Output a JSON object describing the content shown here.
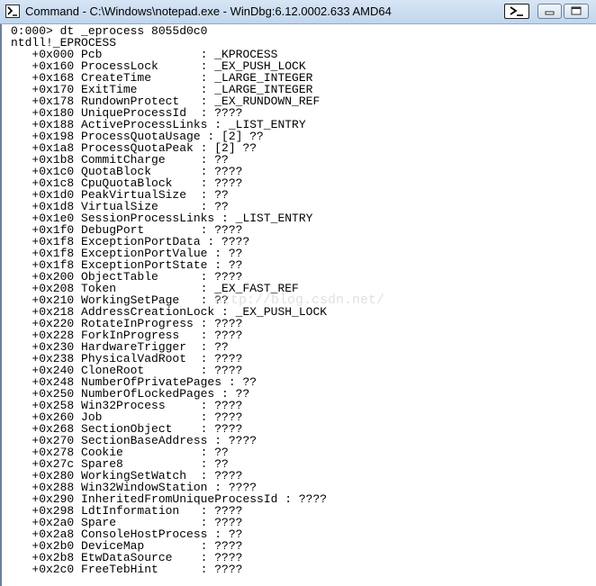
{
  "window": {
    "title": "Command - C:\\Windows\\notepad.exe - WinDbg:6.12.0002.633 AMD64",
    "title_icon": "command-window-icon",
    "controls": {
      "console_icon": "console-icon",
      "minimize_icon": "minimize-icon",
      "maximize_icon": "maximize-icon"
    }
  },
  "output": {
    "lines": [
      "0:000> dt _eprocess 8055d0c0",
      "ntdll!_EPROCESS",
      "   +0x000 Pcb              : _KPROCESS",
      "   +0x160 ProcessLock      : _EX_PUSH_LOCK",
      "   +0x168 CreateTime       : _LARGE_INTEGER",
      "   +0x170 ExitTime         : _LARGE_INTEGER",
      "   +0x178 RundownProtect   : _EX_RUNDOWN_REF",
      "   +0x180 UniqueProcessId  : ????",
      "   +0x188 ActiveProcessLinks : _LIST_ENTRY",
      "   +0x198 ProcessQuotaUsage : [2] ??",
      "   +0x1a8 ProcessQuotaPeak : [2] ??",
      "   +0x1b8 CommitCharge     : ??",
      "   +0x1c0 QuotaBlock       : ????",
      "   +0x1c8 CpuQuotaBlock    : ????",
      "   +0x1d0 PeakVirtualSize  : ??",
      "   +0x1d8 VirtualSize      : ??",
      "   +0x1e0 SessionProcessLinks : _LIST_ENTRY",
      "   +0x1f0 DebugPort        : ????",
      "   +0x1f8 ExceptionPortData : ????",
      "   +0x1f8 ExceptionPortValue : ??",
      "   +0x1f8 ExceptionPortState : ??",
      "   +0x200 ObjectTable      : ????",
      "   +0x208 Token            : _EX_FAST_REF",
      "   +0x210 WorkingSetPage   : ??",
      "   +0x218 AddressCreationLock : _EX_PUSH_LOCK",
      "   +0x220 RotateInProgress : ????",
      "   +0x228 ForkInProgress   : ????",
      "   +0x230 HardwareTrigger  : ??",
      "   +0x238 PhysicalVadRoot  : ????",
      "   +0x240 CloneRoot        : ????",
      "   +0x248 NumberOfPrivatePages : ??",
      "   +0x250 NumberOfLockedPages : ??",
      "   +0x258 Win32Process     : ????",
      "   +0x260 Job              : ????",
      "   +0x268 SectionObject    : ????",
      "   +0x270 SectionBaseAddress : ????",
      "   +0x278 Cookie           : ??",
      "   +0x27c Spare8           : ??",
      "   +0x280 WorkingSetWatch  : ????",
      "   +0x288 Win32WindowStation : ????",
      "   +0x290 InheritedFromUniqueProcessId : ????",
      "   +0x298 LdtInformation   : ????",
      "   +0x2a0 Spare            : ????",
      "   +0x2a8 ConsoleHostProcess : ??",
      "   +0x2b0 DeviceMap        : ????",
      "   +0x2b8 EtwDataSource    : ????",
      "   +0x2c0 FreeTebHint      : ????"
    ]
  },
  "watermark": {
    "text": "http://blog.csdn.net/"
  }
}
